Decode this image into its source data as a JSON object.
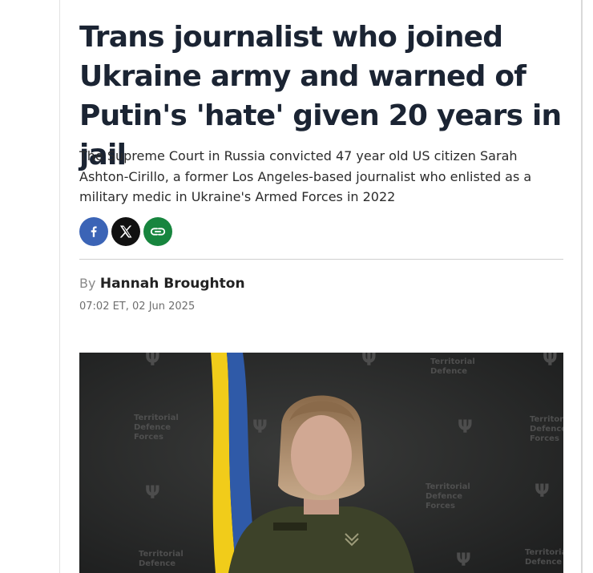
{
  "article": {
    "headline": "Trans journalist who joined Ukraine army and warned of Putin's 'hate' given 20 years in jail",
    "standfirst": "The Supreme Court in Russia convicted 47 year old US citizen Sarah Ashton-Cirillo, a former Los Angeles-based journalist who enlisted as a military medic in Ukraine's Armed Forces in 2022",
    "byline_prefix": "By",
    "author": "Hannah Broughton",
    "timestamp": "07:02 ET, 02 Jun 2025"
  },
  "share": {
    "icons": [
      "facebook-icon",
      "x-icon",
      "link-icon"
    ],
    "colors": {
      "facebook": "#3b64b6",
      "x": "#111111",
      "link": "#17853e"
    }
  },
  "image": {
    "wall_text": [
      "Territorial",
      "Defence",
      "Forces"
    ],
    "colors": {
      "background": "#2a2b2b",
      "flag_blue": "#2f5aa8",
      "flag_yellow": "#f1cc1a"
    }
  }
}
